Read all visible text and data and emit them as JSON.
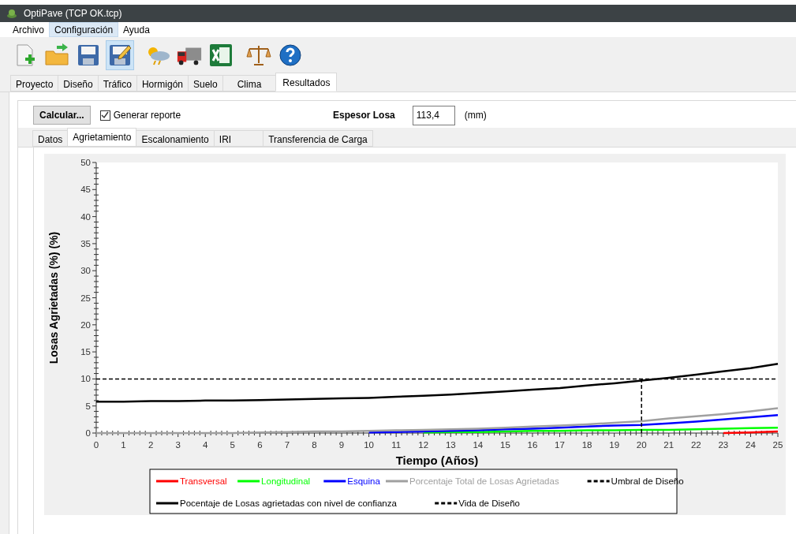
{
  "window": {
    "title": "OptiPave  (TCP OK.tcp)"
  },
  "menu": [
    {
      "label": "Archivo",
      "selected": false
    },
    {
      "label": "Configuración",
      "selected": true
    },
    {
      "label": "Ayuda",
      "selected": false
    }
  ],
  "toolbar": [
    {
      "kind": "new",
      "selected": false
    },
    {
      "kind": "open",
      "selected": false
    },
    {
      "kind": "save",
      "selected": false
    },
    {
      "kind": "saveas",
      "selected": true
    },
    {
      "kind": "weather",
      "selected": false
    },
    {
      "kind": "truck",
      "selected": false
    },
    {
      "kind": "excel",
      "selected": false
    },
    {
      "kind": "scale",
      "selected": false
    },
    {
      "kind": "help",
      "selected": false
    }
  ],
  "tabs": [
    {
      "label": "Proyecto",
      "selected": false
    },
    {
      "label": "Diseño",
      "selected": false
    },
    {
      "label": "Tráfico",
      "selected": false
    },
    {
      "label": "Hormigón",
      "selected": false
    },
    {
      "label": "Suelo",
      "selected": false
    },
    {
      "label": "Clima",
      "selected": false
    },
    {
      "label": "Resultados",
      "selected": true
    }
  ],
  "calc_button": "Calcular...",
  "report": {
    "label": "Generar reporte",
    "checked": true
  },
  "thickness": {
    "label": "Espesor Losa",
    "value": "113,4",
    "unit": "(mm)"
  },
  "subtabs": [
    {
      "label": "Datos",
      "selected": false
    },
    {
      "label": "Agrietamiento",
      "selected": true
    },
    {
      "label": "Escalonamiento",
      "selected": false
    },
    {
      "label": "IRI",
      "selected": false
    },
    {
      "label": "Transferencia de Carga",
      "selected": false
    }
  ],
  "chart_data": {
    "type": "line",
    "xlabel": "Tiempo (Años)",
    "ylabel": "Losas Agrietadas (%) (%)",
    "xlim": [
      0,
      25
    ],
    "ylim": [
      0,
      50
    ],
    "xticks": [
      0,
      1,
      2,
      3,
      4,
      5,
      6,
      7,
      8,
      9,
      10,
      11,
      12,
      13,
      14,
      15,
      16,
      17,
      18,
      19,
      20,
      21,
      22,
      23,
      24,
      25
    ],
    "yticks": [
      0,
      5,
      10,
      15,
      20,
      25,
      30,
      35,
      40,
      45,
      50
    ],
    "x": [
      0,
      1,
      2,
      3,
      4,
      5,
      6,
      7,
      8,
      9,
      10,
      11,
      12,
      13,
      14,
      15,
      16,
      17,
      18,
      19,
      20,
      21,
      22,
      23,
      24,
      25
    ],
    "series": [
      {
        "name": "Transversal",
        "color": "#ff0000",
        "line_style": "solid",
        "values": [
          null,
          null,
          null,
          null,
          null,
          null,
          null,
          null,
          null,
          null,
          null,
          null,
          null,
          null,
          null,
          null,
          null,
          null,
          null,
          null,
          null,
          null,
          null,
          0,
          0.1,
          0.3
        ]
      },
      {
        "name": "Longitudinal",
        "color": "#00ff00",
        "line_style": "solid",
        "values": [
          null,
          null,
          null,
          null,
          null,
          null,
          null,
          null,
          null,
          null,
          null,
          null,
          0.1,
          0.2,
          0.2,
          0.3,
          0.4,
          0.4,
          0.5,
          0.5,
          0.6,
          0.6,
          0.7,
          0.8,
          0.9,
          1.0
        ]
      },
      {
        "name": "Esquina",
        "color": "#0000ff",
        "line_style": "solid",
        "values": [
          null,
          null,
          null,
          null,
          null,
          null,
          null,
          null,
          null,
          null,
          0.1,
          0.2,
          0.3,
          0.4,
          0.5,
          0.7,
          0.8,
          1.0,
          1.2,
          1.4,
          1.5,
          1.8,
          2.1,
          2.5,
          2.9,
          3.3
        ]
      },
      {
        "name": "Porcentaje Total de Losas Agrietadas",
        "color": "#a0a0a0",
        "line_style": "solid",
        "values": [
          0,
          0,
          0,
          0,
          0,
          0,
          0.1,
          0.2,
          0.3,
          0.3,
          0.4,
          0.5,
          0.6,
          0.7,
          0.8,
          1.0,
          1.2,
          1.4,
          1.6,
          1.9,
          2.2,
          2.7,
          3.1,
          3.5,
          4.0,
          4.6
        ]
      },
      {
        "name": "Umbral de Diseño",
        "color": "#000000",
        "line_style": "dashed",
        "values": [
          10,
          10,
          10,
          10,
          10,
          10,
          10,
          10,
          10,
          10,
          10,
          10,
          10,
          10,
          10,
          10,
          10,
          10,
          10,
          10,
          10,
          10,
          10,
          10,
          10,
          10
        ]
      },
      {
        "name": "Pocentaje de Losas agrietadas con nivel de confianza",
        "color": "#000000",
        "line_style": "solid",
        "values": [
          5.8,
          5.8,
          5.9,
          5.9,
          6,
          6,
          6.1,
          6.2,
          6.3,
          6.4,
          6.5,
          6.7,
          6.9,
          7.1,
          7.4,
          7.7,
          8.0,
          8.3,
          8.8,
          9.2,
          9.7,
          10.2,
          10.8,
          11.4,
          12.0,
          12.8
        ]
      }
    ],
    "ref_lines": [
      {
        "axis": "x",
        "value": 20,
        "label": "Vida de Diseño",
        "color": "#000000",
        "line_style": "dashed"
      }
    ],
    "legend": true
  }
}
